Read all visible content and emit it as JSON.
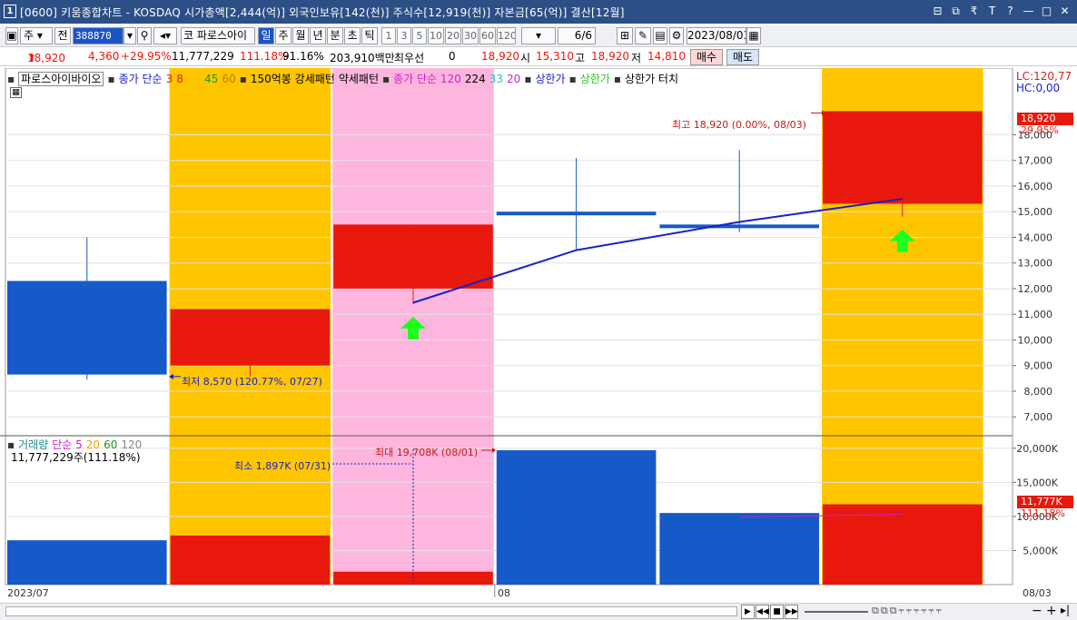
{
  "window": {
    "number": "1",
    "title": "[0600] 키움종합차트 - KOSDAQ 시가총액[2,444(억)] 외국인보유[142(천)] 주식수[12,919(천)] 자본금[65(억)] 결산[12월]",
    "buttons": [
      "⊟",
      "⧉",
      "₹",
      "T",
      "?",
      "—",
      "□",
      "✕"
    ]
  },
  "toolbar": {
    "type_select": "주",
    "jeon": "전",
    "code": "388870",
    "name": "파로스아이",
    "periods": [
      "일",
      "주",
      "월",
      "년",
      "분",
      "초",
      "틱"
    ],
    "active_period": "일",
    "intervals": [
      "1",
      "3",
      "5",
      "10",
      "20",
      "30",
      "60",
      "120"
    ],
    "count": "6/6",
    "date": "2023/08/03"
  },
  "quote": {
    "price": "18,920",
    "change": "4,360",
    "change_pct": "+29.95%",
    "volume": "11,777,229",
    "volume_pct": "111.18%",
    "turnover_pct": "91.16%",
    "amount": "203,910백만",
    "pref_label": "최우선",
    "pref_value": "0",
    "ask": "18,920",
    "open_label": "시",
    "open": "15,310",
    "high_label": "고",
    "high": "18,920",
    "low_label": "저",
    "low": "14,810",
    "buy": "매수",
    "sell": "매도"
  },
  "price_legend": {
    "name": "파로스아이바이오",
    "close_simple": "종가 단순",
    "ma": [
      "3",
      "8",
      "15",
      "45",
      "60"
    ],
    "pattern1": "150억봉 강세패턴",
    "pattern2": "약세패턴",
    "close_simple2": "종가 단순 120",
    "ma2": [
      "224",
      "33",
      "20"
    ],
    "upper_limit": "상한가",
    "upper_limit2": "상한가",
    "upper_touch": "상한가 터치"
  },
  "volume_legend": {
    "name": "거래량",
    "simple": "단순 5",
    "ma": [
      "20",
      "60",
      "120"
    ],
    "value": "11,777,229주(111.18%)"
  },
  "axis_top": {
    "lc": "LC:120,77",
    "hc": "HC:0,00",
    "current": "18,920",
    "current_pct": "29.95%"
  },
  "axis_volume": {
    "current": "11,777K",
    "current_pct": "111.18%"
  },
  "annotations": {
    "high": "최고 18,920 (0.00%, 08/03)",
    "low": "최저 8,570 (120.77%, 07/27)",
    "vol_max": "최대 19,708K (08/01)",
    "vol_min": "최소 1,897K (07/31)"
  },
  "date_labels": [
    "2023/07",
    "08",
    "08/03"
  ],
  "colors": {
    "up": "#e8180c",
    "down": "#1659c8",
    "highlight_yellow": "#ffc600",
    "highlight_pink": "#ffb6de",
    "ma_line": "#1a20c9",
    "arrow": "#1eff1e",
    "vol_ma": "#c81ed2"
  },
  "chart_data": {
    "type": "candlestick",
    "price_axis": {
      "ticks": [
        7000,
        8000,
        9000,
        10000,
        11000,
        12000,
        13000,
        14000,
        15000,
        16000,
        17000,
        18000
      ],
      "tick_labels": [
        "7,000",
        "8,000",
        "9,000",
        "10,000",
        "11,000",
        "12,000",
        "13,000",
        "14,000",
        "15,000",
        "16,000",
        "17,000",
        "18,000"
      ],
      "range": [
        6300,
        20600
      ]
    },
    "volume_axis": {
      "ticks": [
        5000,
        10000,
        15000,
        20000
      ],
      "tick_labels": [
        "5,000K",
        "10,000K",
        "15,000K",
        "20,000K"
      ],
      "range": [
        0,
        21700
      ]
    },
    "candles": [
      {
        "open": 12300,
        "high": 14000,
        "low": 8450,
        "close": 8650,
        "volume": 6500,
        "highlight": "none"
      },
      {
        "open": 9000,
        "high": 11200,
        "low": 8570,
        "close": 11200,
        "volume": 7200,
        "highlight": "yellow"
      },
      {
        "open": 12000,
        "high": 14500,
        "low": 11400,
        "close": 14500,
        "volume": 1897,
        "highlight": "pink"
      },
      {
        "open": 15000,
        "high": 17100,
        "low": 13500,
        "close": 14900,
        "volume": 19708,
        "highlight": "none"
      },
      {
        "open": 14500,
        "high": 17400,
        "low": 14200,
        "close": 14400,
        "volume": 10500,
        "highlight": "none"
      },
      {
        "open": 15310,
        "high": 18920,
        "low": 14810,
        "close": 18920,
        "volume": 11777,
        "highlight": "yellow"
      }
    ],
    "ma3": [
      null,
      null,
      11450,
      13500,
      14600,
      15500
    ],
    "vol_ma": [
      null,
      null,
      null,
      null,
      9900,
      10300
    ],
    "up_arrows": [
      2,
      5
    ]
  }
}
